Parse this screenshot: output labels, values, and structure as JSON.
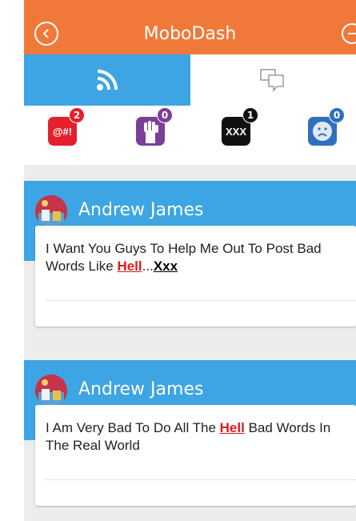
{
  "header": {
    "title": "MoboDash",
    "back_icon": "back-arrow-icon",
    "logout_icon": "logout-icon"
  },
  "tabs": [
    {
      "icon": "rss-feed-icon",
      "active": true
    },
    {
      "icon": "chat-bubbles-icon",
      "active": false
    }
  ],
  "badges": [
    {
      "icon": "cursing-symbols-icon",
      "text": "@#!",
      "count": "2",
      "color": "#e3202b",
      "count_color": "#e3202b"
    },
    {
      "icon": "raised-fist-icon",
      "text": "",
      "count": "0",
      "color": "#7b3f98",
      "count_color": "#7b3f98"
    },
    {
      "icon": "xxx-icon",
      "text": "XXX",
      "count": "1",
      "color": "#111111",
      "count_color": "#111111"
    },
    {
      "icon": "sad-face-icon",
      "text": "",
      "count": "0",
      "color": "#2f6fbf",
      "count_color": "#2f6fbf"
    }
  ],
  "posts": [
    {
      "author": "Andrew James",
      "text_before": "I Want You Guys To Help Me Out To Post Bad Words Like ",
      "highlight1": "Hell",
      "text_middle": "...",
      "highlight2": "Xxx",
      "text_after": ""
    },
    {
      "author": "Andrew James",
      "text_before": "I Am Very Bad To Do All The ",
      "highlight1": "Hell",
      "text_middle": " Bad Words In The Real World",
      "highlight2": "",
      "text_after": ""
    }
  ]
}
